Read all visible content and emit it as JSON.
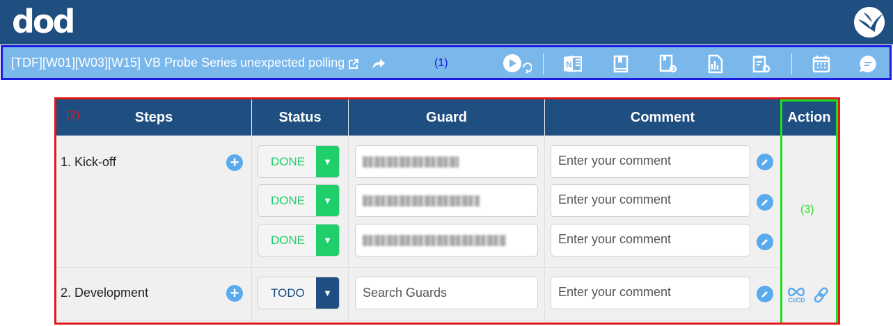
{
  "header": {
    "logo_text": "dod",
    "brand_icon": "bird-icon"
  },
  "toolbar": {
    "title": "[TDF][W01][W03][W15] VB Probe Series unexpected polling",
    "annotation": "(1)",
    "icons": [
      "external-link-icon",
      "share-icon",
      "play-refresh-icon",
      "onenote-icon",
      "book-icon",
      "book-settings-icon",
      "file-chart-icon",
      "clipboard-settings-icon",
      "calendar-icon",
      "chat-icon"
    ]
  },
  "table": {
    "annotation": "(2)",
    "headers": [
      "Steps",
      "Status",
      "Guard",
      "Comment",
      "Action"
    ],
    "steps": [
      {
        "label": "1. Kick-off",
        "entries": [
          {
            "status": "DONE",
            "guard_value": "",
            "comment_placeholder": "Enter your comment"
          },
          {
            "status": "DONE",
            "guard_value": "",
            "comment_placeholder": "Enter your comment"
          },
          {
            "status": "DONE",
            "guard_value": "",
            "comment_placeholder": "Enter your comment"
          }
        ]
      },
      {
        "label": "2. Development",
        "entries": [
          {
            "status": "TODO",
            "guard_placeholder": "Search Guards",
            "comment_placeholder": "Enter your comment"
          }
        ]
      }
    ],
    "action": {
      "annotation": "(3)",
      "cicd_label": "CI/CD",
      "icons": [
        "ci-cd-infinity-icon",
        "link-icon"
      ]
    }
  },
  "colors": {
    "header_bg": "#1f4e80",
    "toolbar_bg": "#7ab8ec",
    "done_green": "#1ecf6a",
    "todo_blue": "#1f4e80",
    "accent_blue": "#5aaaee"
  }
}
